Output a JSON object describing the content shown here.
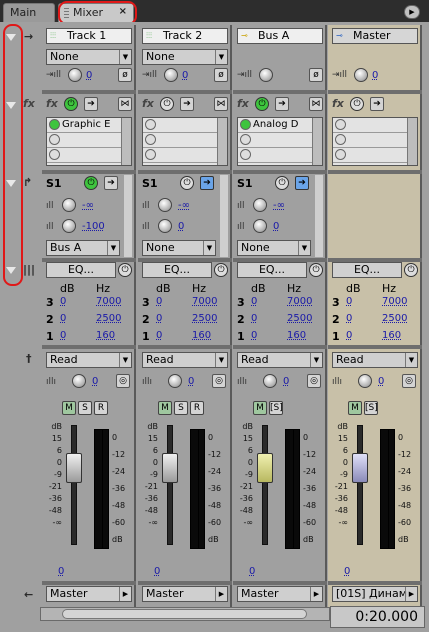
{
  "tabs": {
    "main": "Main",
    "mixer": "Mixer",
    "close": "×",
    "menu": "▶"
  },
  "strips": [
    {
      "id": "track1",
      "name": "Track 1",
      "input": "None",
      "input_val": "0",
      "fx": [
        "Graphic E",
        "",
        ""
      ],
      "send_val1": "-∞",
      "send_val2": "-100",
      "send_out": "Bus A",
      "eq": "EQ...",
      "eq_db": [
        "0",
        "0",
        "0"
      ],
      "eq_hz": [
        "7000",
        "2500",
        "160"
      ],
      "auto": "Read",
      "auto_val": "0",
      "msr": [
        "M",
        "S",
        "R"
      ],
      "vol": "0",
      "output": "Master"
    },
    {
      "id": "track2",
      "name": "Track 2",
      "input": "None",
      "input_val": "0",
      "fx": [
        "",
        "",
        ""
      ],
      "send_val1": "-∞",
      "send_val2": "0",
      "send_out": "None",
      "eq": "EQ...",
      "eq_db": [
        "0",
        "0",
        "0"
      ],
      "eq_hz": [
        "7000",
        "2500",
        "160"
      ],
      "auto": "Read",
      "auto_val": "0",
      "msr": [
        "M",
        "S",
        "R"
      ],
      "vol": "0",
      "output": "Master"
    },
    {
      "id": "busa",
      "name": "Bus A",
      "input": "",
      "input_val": "",
      "fx": [
        "Analog D",
        "",
        ""
      ],
      "send_val1": "-∞",
      "send_val2": "0",
      "send_out": "None",
      "eq": "EQ...",
      "eq_db": [
        "0",
        "0",
        "0"
      ],
      "eq_hz": [
        "7000",
        "2500",
        "160"
      ],
      "auto": "Read",
      "auto_val": "0",
      "msr": [
        "M",
        "[S]"
      ],
      "vol": "0",
      "output": "Master"
    },
    {
      "id": "master",
      "name": "Master",
      "input": "",
      "input_val": "",
      "fx": [
        "",
        "",
        ""
      ],
      "send_val1": "",
      "send_val2": "",
      "send_out": "",
      "eq": "EQ...",
      "eq_db": [
        "0",
        "0",
        "0"
      ],
      "eq_hz": [
        "7000",
        "2500",
        "160"
      ],
      "auto": "Read",
      "auto_val": "0",
      "msr": [
        "M",
        "[S]"
      ],
      "vol": "0",
      "output": "[01S] Динам"
    }
  ],
  "labels": {
    "s1": "S1",
    "db": "dB",
    "hz": "Hz",
    "band3": "3",
    "band2": "2",
    "band1": "1",
    "fx": "fx"
  },
  "fader_scale": [
    "dB",
    "15",
    "6",
    "0",
    "-9",
    "-21",
    "-36",
    "-48",
    "-∞"
  ],
  "meter_scale": [
    "0",
    "-12",
    "-24",
    "-36",
    "-48",
    "-60",
    "dB"
  ],
  "time": "0:20.000",
  "colors": {
    "panel": "#a0a0a0",
    "master": "#c8c0a8",
    "on": "#3ec43e",
    "value": "#1a1aa8"
  }
}
